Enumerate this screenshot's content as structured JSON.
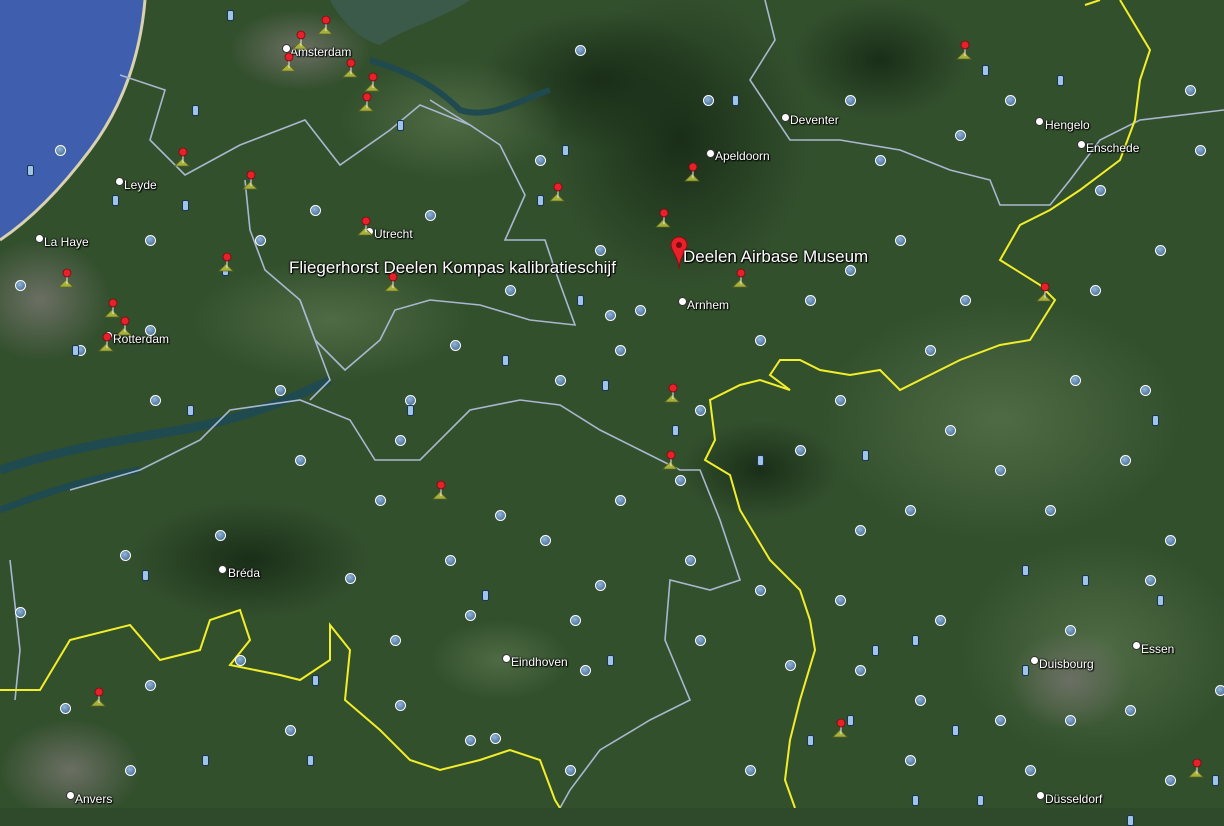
{
  "colors": {
    "sea": "#3f5fae",
    "land": "#2f4a2a",
    "border_country": "#f2ee2a",
    "border_region": "#a9b7cf",
    "pin": "#e8202a"
  },
  "labels": {
    "museum": "Deelen Airbase Museum",
    "kompas": "Fliegerhorst Deelen Kompas kalibratieschijf",
    "cities": [
      {
        "name": "Amsterdam"
      },
      {
        "name": "Deventer"
      },
      {
        "name": "Hengelo"
      },
      {
        "name": "Enschede"
      },
      {
        "name": "Apeldoorn"
      },
      {
        "name": "Leyde"
      },
      {
        "name": "Utrecht"
      },
      {
        "name": "La Haye"
      },
      {
        "name": "Arnhem"
      },
      {
        "name": "Rotterdam"
      },
      {
        "name": "Bréda"
      },
      {
        "name": "Eindhoven"
      },
      {
        "name": "Duisbourg"
      },
      {
        "name": "Essen"
      },
      {
        "name": "Anvers"
      },
      {
        "name": "Düsseldorf"
      }
    ]
  },
  "marker_icons": [
    "red-pin-icon",
    "photo-circle-icon",
    "camera-icon"
  ]
}
